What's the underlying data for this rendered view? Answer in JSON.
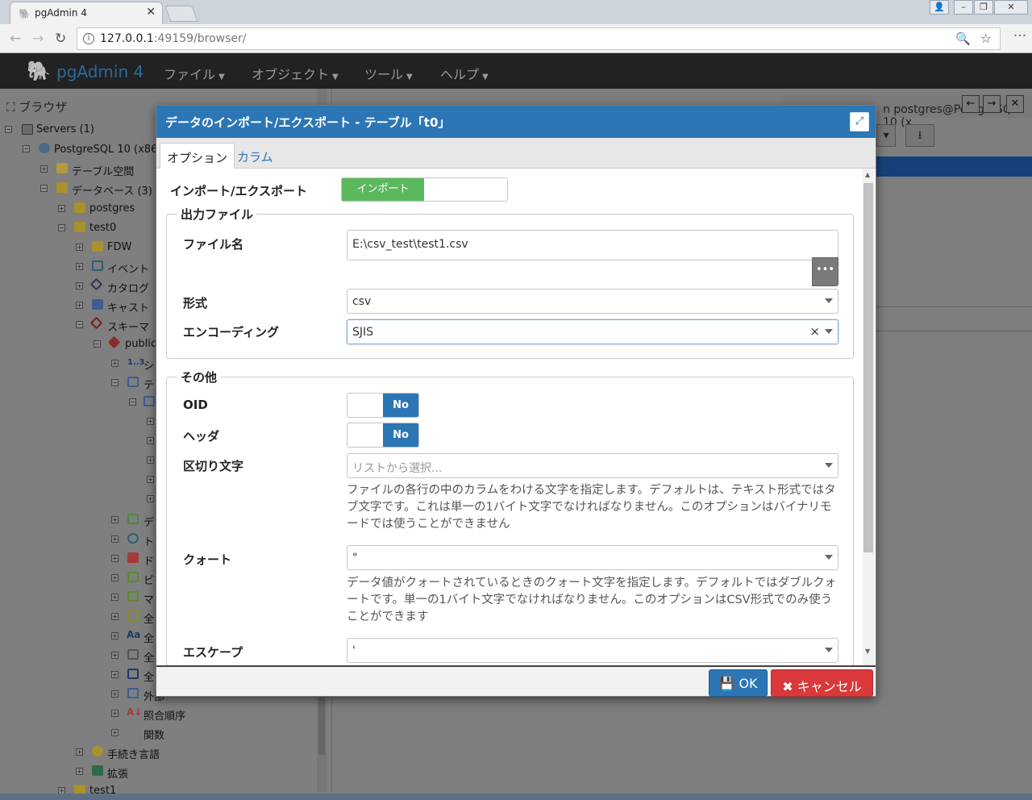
{
  "browser": {
    "tab_title": "pgAdmin 4",
    "url_host": "127.0.0.1",
    "url_rest": ":49159/browser/"
  },
  "app": {
    "brand": "pgAdmin 4",
    "menu": [
      {
        "label": "ファイル"
      },
      {
        "label": "オブジェクト"
      },
      {
        "label": "ツール"
      },
      {
        "label": "ヘルプ"
      }
    ]
  },
  "browser_panel": {
    "title": "ブラウザ",
    "tree": [
      {
        "label": "Servers (1)"
      },
      {
        "label": "PostgreSQL 10 (x86)"
      },
      {
        "label": "テーブル空間"
      },
      {
        "label": "データベース (3)"
      },
      {
        "label": "postgres"
      },
      {
        "label": "test0"
      },
      {
        "label": "FDW"
      },
      {
        "label": "イベント"
      },
      {
        "label": "カタログ"
      },
      {
        "label": "キャスト"
      },
      {
        "label": "スキーマ"
      },
      {
        "label": "public"
      },
      {
        "label": "シ"
      },
      {
        "label": "テ"
      },
      {
        "label": "デ"
      },
      {
        "label": "ト"
      },
      {
        "label": "ド"
      },
      {
        "label": "ビ"
      },
      {
        "label": "マ"
      },
      {
        "label": "全"
      },
      {
        "label": "全"
      },
      {
        "label": "全"
      },
      {
        "label": "全"
      },
      {
        "label": "外部"
      },
      {
        "label": "照合順序"
      },
      {
        "label": "関数"
      },
      {
        "label": "手続き言語"
      },
      {
        "label": "拡張"
      },
      {
        "label": "test1"
      }
    ]
  },
  "right_panel": {
    "connection_label": "n postgres@PostgreSQL 10 (x"
  },
  "dialog": {
    "title": "データのインポート/エクスポート - テーブル「t0」",
    "tabs": [
      {
        "label": "オプション",
        "active": true
      },
      {
        "label": "カラム",
        "active": false
      }
    ],
    "import_export": {
      "label": "インポート/エクスポート",
      "value": "インポート"
    },
    "output_file": {
      "legend": "出力ファイル",
      "filename_label": "ファイル名",
      "filename_value": "E:\\csv_test\\test1.csv",
      "browse_label": "•••",
      "format_label": "形式",
      "format_value": "csv",
      "encoding_label": "エンコーディング",
      "encoding_value": "SJIS",
      "clear_label": "×"
    },
    "other": {
      "legend": "その他",
      "oid_label": "OID",
      "oid_value": "No",
      "header_label": "ヘッダ",
      "header_value": "No",
      "delimiter_label": "区切り文字",
      "delimiter_placeholder": "リストから選択...",
      "delimiter_help": "ファイルの各行の中のカラムをわける文字を指定します。デフォルトは、テキスト形式ではタブ文字です。これは単一の1バイト文字でなければなりません。このオプションはバイナリモードでは使うことができません",
      "quote_label": "クォート",
      "quote_value": "\"",
      "quote_help": "データ値がクォートされているときのクォート文字を指定します。デフォルトではダブルクォートです。単一の1バイト文字でなければなりません。このオプションはCSV形式でのみ使うことができます",
      "escape_label": "エスケープ",
      "escape_value": "'"
    },
    "footer": {
      "ok_label": "OK",
      "cancel_label": "キャンセル"
    }
  },
  "colors": {
    "dialog_header": "#2c76b5",
    "toggle_on": "#5cb85c",
    "cancel": "#d9393a"
  }
}
